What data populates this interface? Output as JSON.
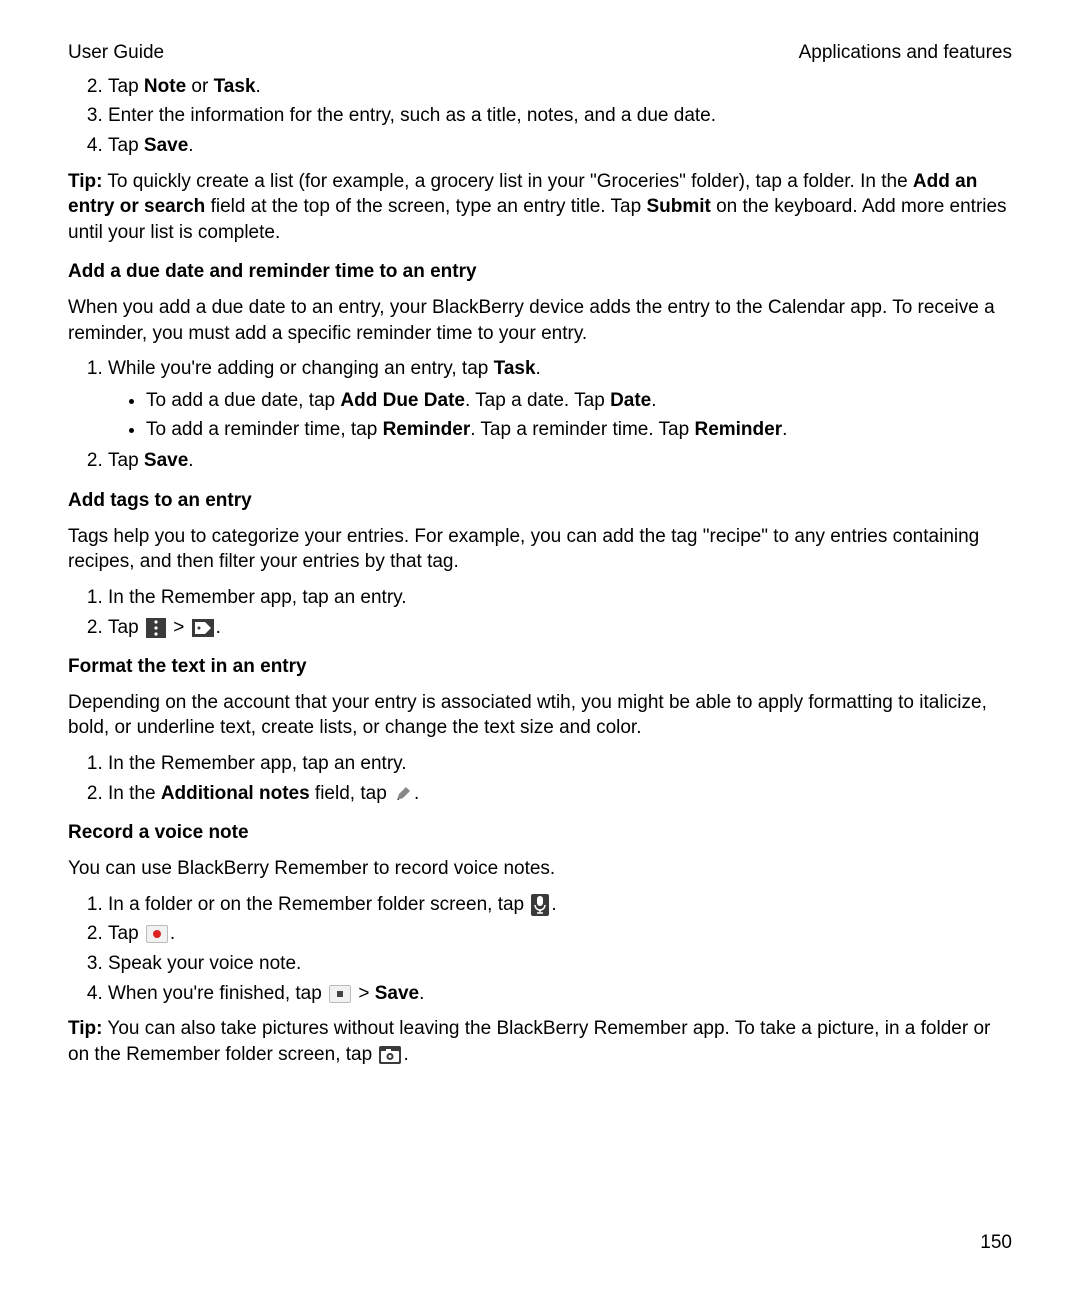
{
  "header": {
    "left": "User Guide",
    "right": "Applications and features"
  },
  "intro_list": {
    "start": 2,
    "items": [
      {
        "pre": "Tap ",
        "b1": "Note",
        "mid": " or ",
        "b2": "Task",
        "post": "."
      },
      {
        "text": "Enter the information for the entry, such as a title, notes, and a due date."
      },
      {
        "pre": "Tap ",
        "b1": "Save",
        "post": "."
      }
    ]
  },
  "tip1": {
    "label": "Tip:",
    "line1a": " To quickly create a list (for example, a grocery list in your \"Groceries\" folder), tap a folder. In the ",
    "bold1": "Add an entry or search",
    "line1b": " field at the top of the screen, type an entry title. Tap ",
    "bold2": "Submit",
    "line1c": " on the keyboard. Add more entries until your list is complete."
  },
  "section_due": {
    "heading": "Add a due date and reminder time to an entry",
    "intro": "When you add a due date to an entry, your BlackBerry device adds the entry to the Calendar app. To receive a reminder, you must add a specific reminder time to your entry.",
    "step1_pre": "While you're adding or changing an entry, tap ",
    "step1_b": "Task",
    "step1_post": ".",
    "bullet1_pre": "To add a due date, tap ",
    "bullet1_b1": "Add Due Date",
    "bullet1_mid": ". Tap a date. Tap ",
    "bullet1_b2": "Date",
    "bullet1_post": ".",
    "bullet2_pre": "To add a reminder time, tap ",
    "bullet2_b1": "Reminder",
    "bullet2_mid": ". Tap a reminder time. Tap ",
    "bullet2_b2": "Reminder",
    "bullet2_post": ".",
    "step2_pre": "Tap ",
    "step2_b": "Save",
    "step2_post": "."
  },
  "section_tags": {
    "heading": "Add tags to an entry",
    "intro": "Tags help you to categorize your entries. For example, you can add the tag \"recipe\" to any entries containing recipes, and then filter your entries by that tag.",
    "step1": "In the Remember app, tap an entry.",
    "step2_pre": "Tap ",
    "step2_sep": " > ",
    "step2_post": "."
  },
  "section_format": {
    "heading": "Format the text in an entry",
    "intro": "Depending on the account that your entry is associated wtih, you might be able to apply formatting to italicize, bold, or underline text, create lists, or change the text size and color.",
    "step1": "In the Remember app, tap an entry.",
    "step2_pre": "In the ",
    "step2_b": "Additional notes",
    "step2_mid": " field, tap ",
    "step2_post": "."
  },
  "section_voice": {
    "heading": "Record a voice note",
    "intro": "You can use BlackBerry Remember to record voice notes.",
    "step1_pre": "In a folder or on the Remember folder screen, tap ",
    "step1_post": ".",
    "step2_pre": "Tap ",
    "step2_post": ".",
    "step3": "Speak your voice note.",
    "step4_pre": "When you're finished, tap ",
    "step4_sep": " > ",
    "step4_b": "Save",
    "step4_post": "."
  },
  "tip2": {
    "label": "Tip:",
    "text_a": " You can also take pictures without leaving the BlackBerry Remember app. To take a picture, in a folder or on the Remember folder screen, tap ",
    "text_b": "."
  },
  "page_number": "150"
}
